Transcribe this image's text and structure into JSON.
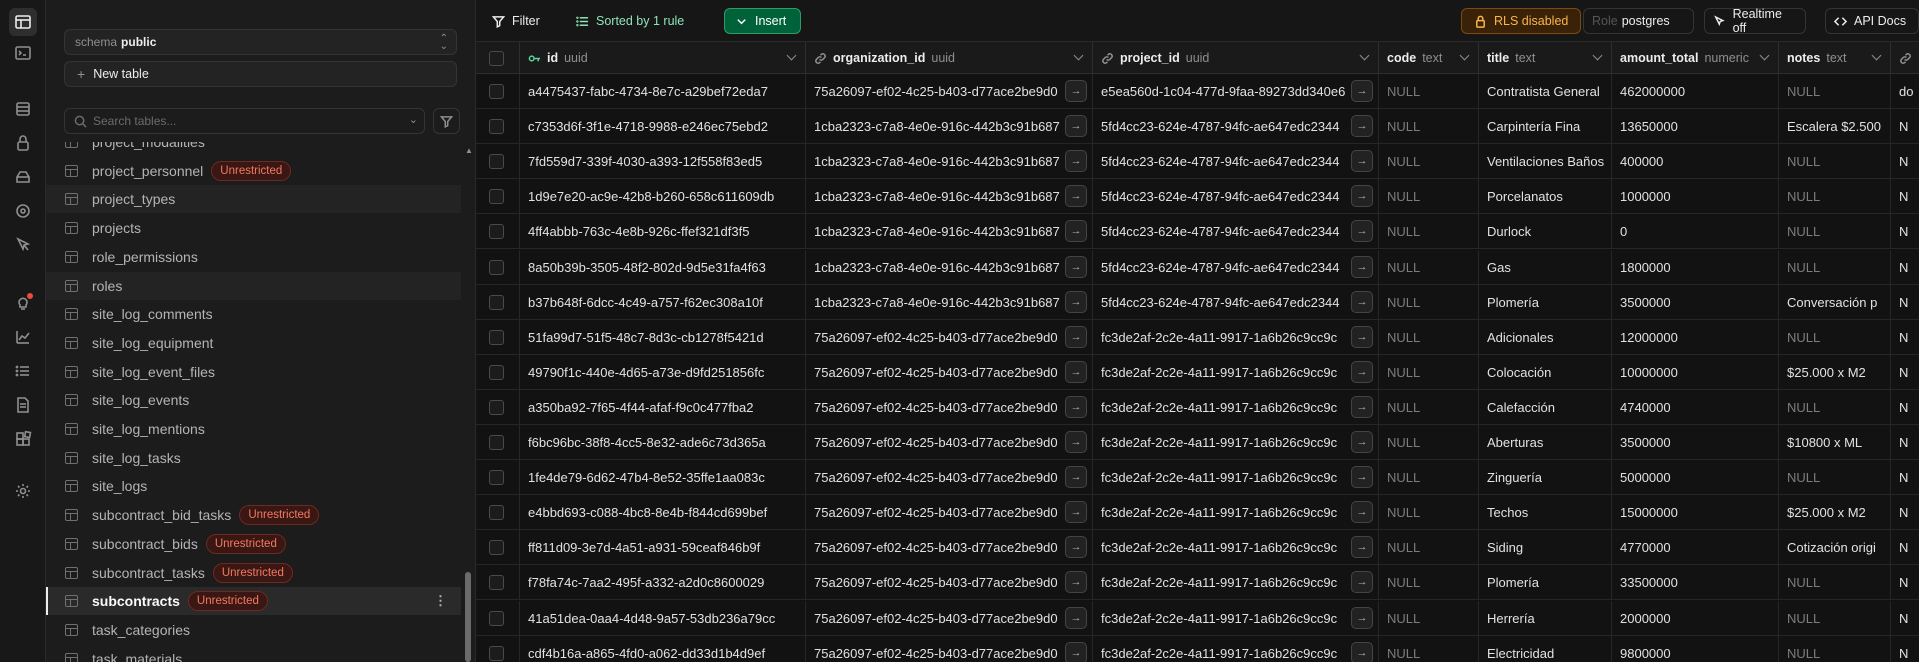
{
  "sidebar": {
    "schema_label": "schema",
    "schema_value": "public",
    "new_table_label": "New table",
    "search_placeholder": "Search tables...",
    "tables": [
      {
        "name": "project_modalities",
        "badge": ""
      },
      {
        "name": "project_personnel",
        "badge": "Unrestricted"
      },
      {
        "name": "project_types",
        "badge": ""
      },
      {
        "name": "projects",
        "badge": ""
      },
      {
        "name": "role_permissions",
        "badge": ""
      },
      {
        "name": "roles",
        "badge": ""
      },
      {
        "name": "site_log_comments",
        "badge": ""
      },
      {
        "name": "site_log_equipment",
        "badge": ""
      },
      {
        "name": "site_log_event_files",
        "badge": ""
      },
      {
        "name": "site_log_events",
        "badge": ""
      },
      {
        "name": "site_log_mentions",
        "badge": ""
      },
      {
        "name": "site_log_tasks",
        "badge": ""
      },
      {
        "name": "site_logs",
        "badge": ""
      },
      {
        "name": "subcontract_bid_tasks",
        "badge": "Unrestricted"
      },
      {
        "name": "subcontract_bids",
        "badge": "Unrestricted"
      },
      {
        "name": "subcontract_tasks",
        "badge": "Unrestricted"
      },
      {
        "name": "subcontracts",
        "badge": "Unrestricted"
      },
      {
        "name": "task_categories",
        "badge": ""
      },
      {
        "name": "task_materials",
        "badge": ""
      }
    ],
    "selected_table": "subcontracts"
  },
  "toolbar": {
    "filter_label": "Filter",
    "sort_label": "Sorted by 1 rule",
    "insert_label": "Insert",
    "rls_label": "RLS disabled",
    "role_label": "Role",
    "role_value": "postgres",
    "realtime_label": "Realtime off",
    "api_docs_label": "API Docs"
  },
  "columns": [
    {
      "name": "id",
      "type": "uuid"
    },
    {
      "name": "organization_id",
      "type": "uuid"
    },
    {
      "name": "project_id",
      "type": "uuid"
    },
    {
      "name": "code",
      "type": "text"
    },
    {
      "name": "title",
      "type": "text"
    },
    {
      "name": "amount_total",
      "type": "numeric"
    },
    {
      "name": "notes",
      "type": "text"
    }
  ],
  "rows": [
    [
      "a4475437-fabc-4734-8e7c-a29bef72eda7",
      "75a26097-ef02-4c25-b403-d77ace2be9d0",
      "e5ea560d-1c04-477d-9faa-89273dd340e6",
      "NULL",
      "Contratista General",
      "462000000",
      "NULL",
      "do"
    ],
    [
      "c7353d6f-3f1e-4718-9988-e246ec75ebd2",
      "1cba2323-c7a8-4e0e-916c-442b3c91b687",
      "5fd4cc23-624e-4787-94fc-ae647edc2344",
      "NULL",
      "Carpintería Fina",
      "13650000",
      "Escalera $2.500",
      "N"
    ],
    [
      "7fd559d7-339f-4030-a393-12f558f83ed5",
      "1cba2323-c7a8-4e0e-916c-442b3c91b687",
      "5fd4cc23-624e-4787-94fc-ae647edc2344",
      "NULL",
      "Ventilaciones Baños",
      "400000",
      "NULL",
      "N"
    ],
    [
      "1d9e7e20-ac9e-42b8-b260-658c611609db",
      "1cba2323-c7a8-4e0e-916c-442b3c91b687",
      "5fd4cc23-624e-4787-94fc-ae647edc2344",
      "NULL",
      "Porcelanatos",
      "1000000",
      "NULL",
      "N"
    ],
    [
      "4ff4abbb-763c-4e8b-926c-ffef321df3f5",
      "1cba2323-c7a8-4e0e-916c-442b3c91b687",
      "5fd4cc23-624e-4787-94fc-ae647edc2344",
      "NULL",
      "Durlock",
      "0",
      "NULL",
      "N"
    ],
    [
      "8a50b39b-3505-48f2-802d-9d5e31fa4f63",
      "1cba2323-c7a8-4e0e-916c-442b3c91b687",
      "5fd4cc23-624e-4787-94fc-ae647edc2344",
      "NULL",
      "Gas",
      "1800000",
      "NULL",
      "N"
    ],
    [
      "b37b648f-6dcc-4c49-a757-f62ec308a10f",
      "1cba2323-c7a8-4e0e-916c-442b3c91b687",
      "5fd4cc23-624e-4787-94fc-ae647edc2344",
      "NULL",
      "Plomería",
      "3500000",
      "Conversación p",
      "N"
    ],
    [
      "51fa99d7-51f5-48c7-8d3c-cb1278f5421d",
      "75a26097-ef02-4c25-b403-d77ace2be9d0",
      "fc3de2af-2c2e-4a11-9917-1a6b26c9cc9c",
      "NULL",
      "Adicionales",
      "12000000",
      "NULL",
      "N"
    ],
    [
      "49790f1c-440e-4d65-a73e-d9fd251856fc",
      "75a26097-ef02-4c25-b403-d77ace2be9d0",
      "fc3de2af-2c2e-4a11-9917-1a6b26c9cc9c",
      "NULL",
      "Colocación",
      "10000000",
      "$25.000 x M2",
      "N"
    ],
    [
      "a350ba92-7f65-4f44-afaf-f9c0c477fba2",
      "75a26097-ef02-4c25-b403-d77ace2be9d0",
      "fc3de2af-2c2e-4a11-9917-1a6b26c9cc9c",
      "NULL",
      "Calefacción",
      "4740000",
      "NULL",
      "N"
    ],
    [
      "f6bc96bc-38f8-4cc5-8e32-ade6c73d365a",
      "75a26097-ef02-4c25-b403-d77ace2be9d0",
      "fc3de2af-2c2e-4a11-9917-1a6b26c9cc9c",
      "NULL",
      "Aberturas",
      "3500000",
      "$10800 x ML",
      "N"
    ],
    [
      "1fe4de79-6d62-47b4-8e52-35ffe1aa083c",
      "75a26097-ef02-4c25-b403-d77ace2be9d0",
      "fc3de2af-2c2e-4a11-9917-1a6b26c9cc9c",
      "NULL",
      "Zinguería",
      "5000000",
      "NULL",
      "N"
    ],
    [
      "e4bbd693-c088-4bc8-8e4b-f844cd699bef",
      "75a26097-ef02-4c25-b403-d77ace2be9d0",
      "fc3de2af-2c2e-4a11-9917-1a6b26c9cc9c",
      "NULL",
      "Techos",
      "15000000",
      "$25.000 x M2",
      "N"
    ],
    [
      "ff811d09-3e7d-4a51-a931-59ceaf846b9f",
      "75a26097-ef02-4c25-b403-d77ace2be9d0",
      "fc3de2af-2c2e-4a11-9917-1a6b26c9cc9c",
      "NULL",
      "Siding",
      "4770000",
      "Cotización origi",
      "N"
    ],
    [
      "f78fa74c-7aa2-495f-a332-a2d0c8600029",
      "75a26097-ef02-4c25-b403-d77ace2be9d0",
      "fc3de2af-2c2e-4a11-9917-1a6b26c9cc9c",
      "NULL",
      "Plomería",
      "33500000",
      "NULL",
      "N"
    ],
    [
      "41a51dea-0aa4-4d48-9a57-53db236a79cc",
      "75a26097-ef02-4c25-b403-d77ace2be9d0",
      "fc3de2af-2c2e-4a11-9917-1a6b26c9cc9c",
      "NULL",
      "Herrería",
      "2000000",
      "NULL",
      "N"
    ],
    [
      "cdf4b16a-a865-4fd0-a062-dd33d1b4d9ef",
      "75a26097-ef02-4c25-b403-d77ace2be9d0",
      "fc3de2af-2c2e-4a11-9917-1a6b26c9cc9c",
      "NULL",
      "Electricidad",
      "9800000",
      "NULL",
      "N"
    ]
  ],
  "colors": {
    "accent_green": "#006239",
    "badge_red": "#f27963",
    "rls_orange": "#fab54a"
  }
}
